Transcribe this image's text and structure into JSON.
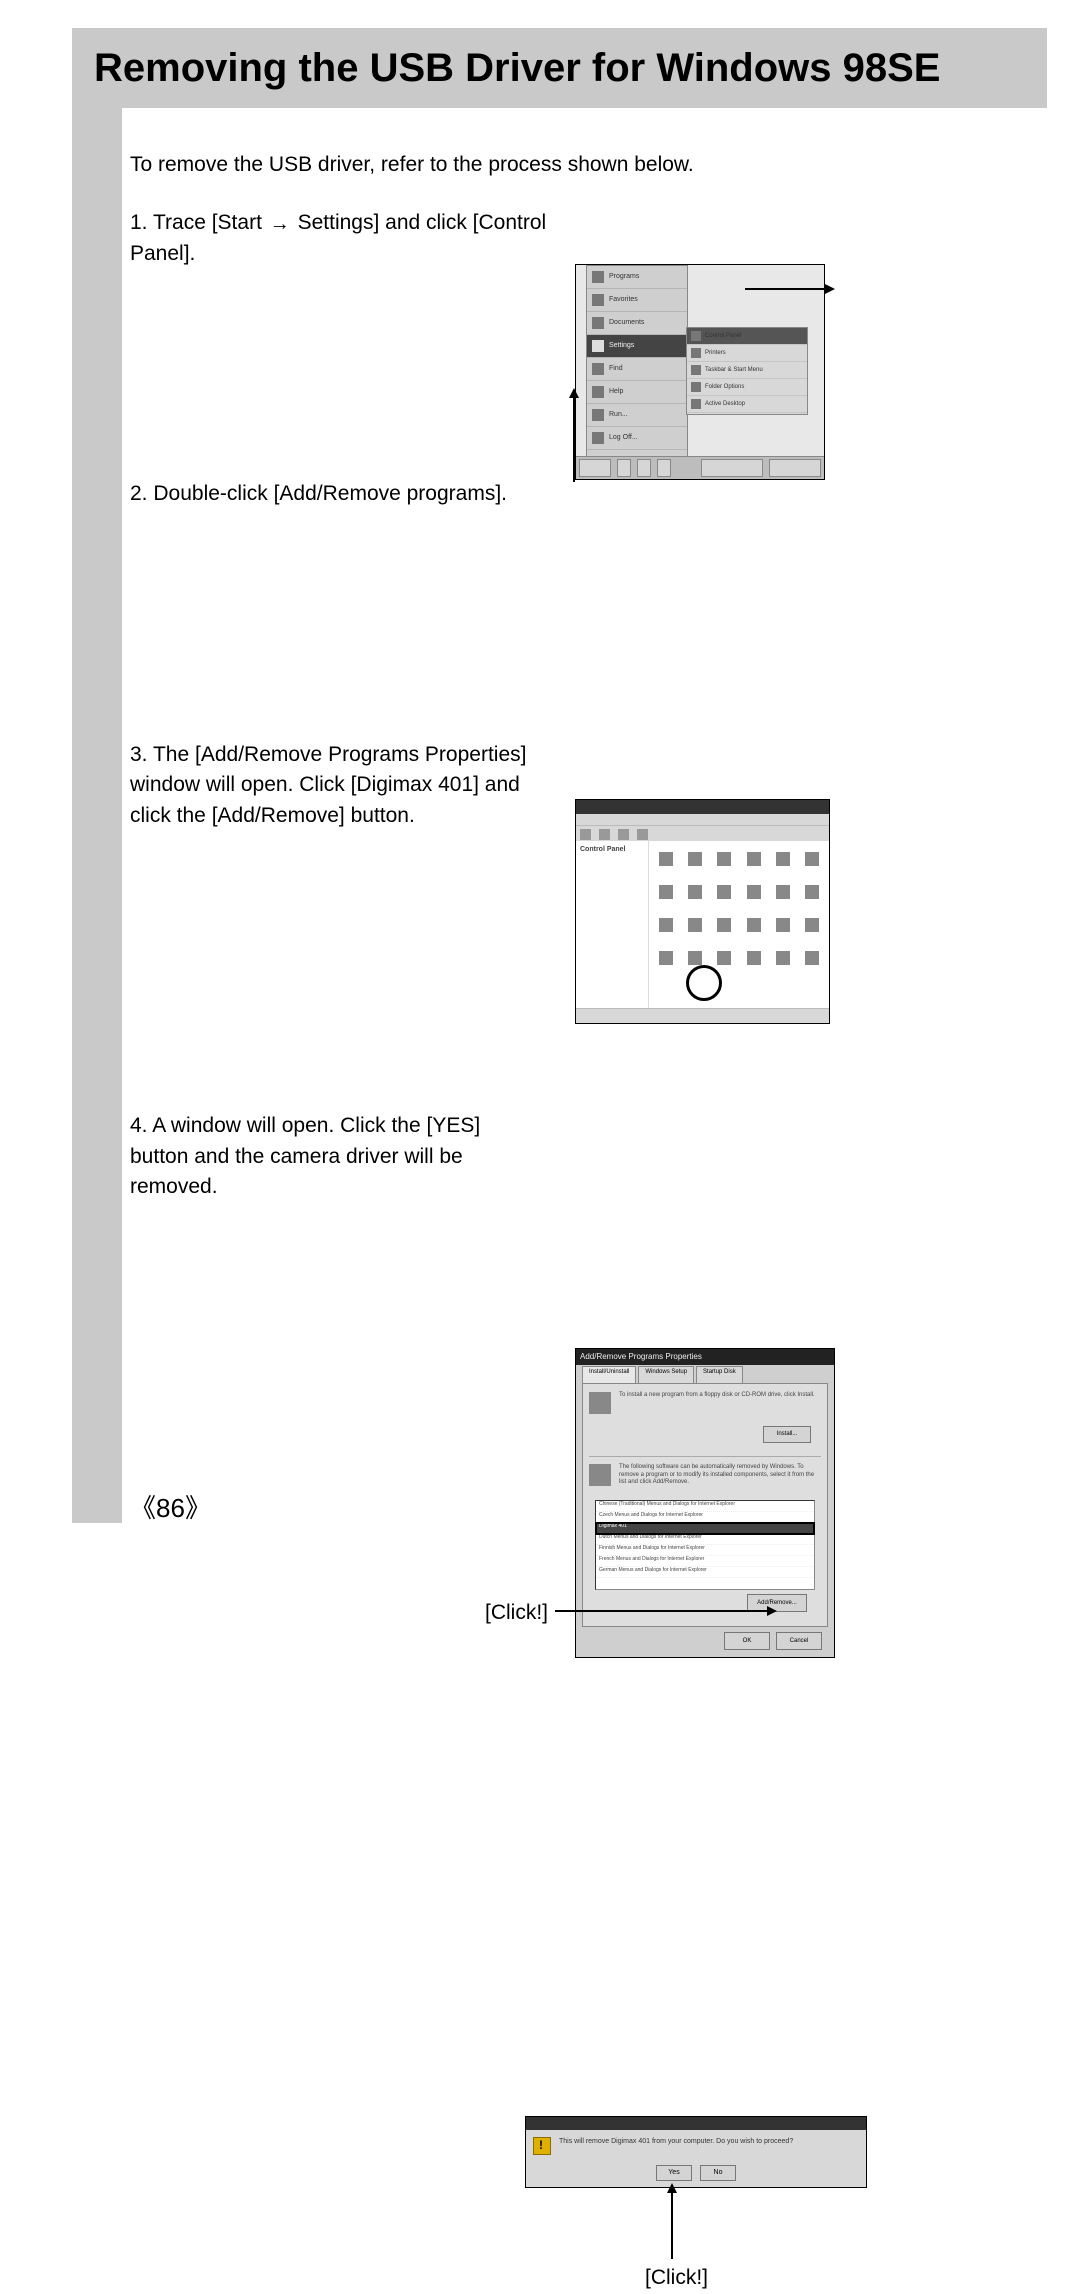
{
  "title": "Removing the USB Driver for Windows 98SE",
  "intro": "To remove the USB driver, refer to the process shown below.",
  "steps": {
    "s1": {
      "num": "1.",
      "pre": "Trace [Start",
      "arrow": "→",
      "post": "Settings] and click [Control Panel]."
    },
    "s2": {
      "num": "2.",
      "text": "Double-click [Add/Remove programs]."
    },
    "s3": {
      "num": "3.",
      "text": "The [Add/Remove Programs Properties] window will open. Click [Digimax 401] and click the [Add/Remove] button."
    },
    "s4": {
      "num": "4.",
      "text": "A window will open. Click the [YES] button and the camera driver will be removed."
    }
  },
  "annotations": {
    "click3": "[Click!]",
    "click4": "[Click!]"
  },
  "fig1": {
    "start_items": [
      "Programs",
      "Favorites",
      "Documents",
      "Settings",
      "Find",
      "Help",
      "Run...",
      "Log Off..."
    ],
    "settings_items": [
      "Control Panel",
      "Printers",
      "Taskbar & Start Menu",
      "Folder Options",
      "Active Desktop"
    ]
  },
  "fig2": {
    "sidebar_title": "Control Panel",
    "icon_count": 24
  },
  "fig3": {
    "titlebar": "Add/Remove Programs Properties",
    "tabs": [
      "Install/Uninstall",
      "Windows Setup",
      "Startup Disk"
    ],
    "list": [
      "Chinese (Traditional) Menus and Dialogs for Internet Explorer",
      "Czech Menus and Dialogs for Internet Explorer",
      "Digimax 401",
      "Dutch Menus and Dialogs for Internet Explorer",
      "Finnish Menus and Dialogs for Internet Explorer",
      "French Menus and Dialogs for Internet Explorer",
      "German Menus and Dialogs for Internet Explorer"
    ],
    "install_btn": "Install...",
    "addremove_btn": "Add/Remove...",
    "ok_btn": "OK",
    "cancel_btn": "Cancel"
  },
  "fig4": {
    "msg": "This will remove Digimax 401 from your computer. Do you wish to proceed?",
    "yes": "Yes",
    "no": "No"
  },
  "page_number": "86"
}
